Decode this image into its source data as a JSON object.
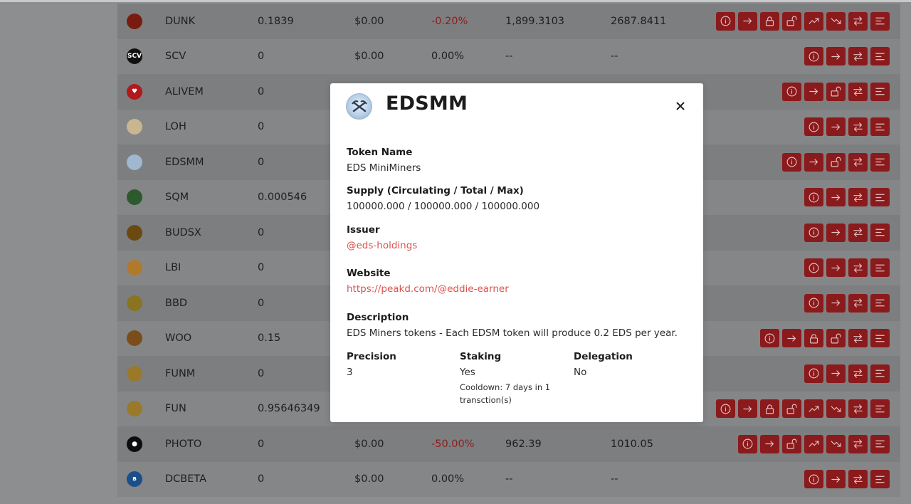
{
  "rows": [
    {
      "symbol": "DUNK",
      "balance": "0.1839",
      "usd": "$0.00",
      "change": "-0.20%",
      "change_negative": true,
      "volume": "1,899.3103",
      "mcap": "2687.8411",
      "icon_bg": "#7a1b10",
      "icon_text": "",
      "actions": [
        "info-icon",
        "transfer-icon",
        "lock-icon",
        "unlock-icon",
        "trend-up-icon",
        "trend-down-icon",
        "swap-icon",
        "menu-icon"
      ]
    },
    {
      "symbol": "SCV",
      "balance": "0",
      "usd": "$0.00",
      "change": "0.00%",
      "change_negative": false,
      "volume": "--",
      "mcap": "--",
      "icon_bg": "#111111",
      "icon_text": "SCV",
      "actions": [
        "info-icon",
        "transfer-icon",
        "swap-icon",
        "menu-icon"
      ]
    },
    {
      "symbol": "ALIVEM",
      "balance": "0",
      "usd": "",
      "change": "",
      "change_negative": false,
      "volume": "",
      "mcap": "",
      "icon_bg": "#b3181c",
      "icon_text": "♥",
      "actions": [
        "info-icon",
        "transfer-icon",
        "unlock-icon",
        "swap-icon",
        "menu-icon"
      ]
    },
    {
      "symbol": "LOH",
      "balance": "0",
      "usd": "",
      "change": "",
      "change_negative": false,
      "volume": "",
      "mcap": "",
      "icon_bg": "#c7b690",
      "icon_text": "",
      "actions": [
        "info-icon",
        "transfer-icon",
        "swap-icon",
        "menu-icon"
      ]
    },
    {
      "symbol": "EDSMM",
      "balance": "0",
      "usd": "",
      "change": "",
      "change_negative": false,
      "volume": "",
      "mcap": "",
      "icon_bg": "#9fb8d0",
      "icon_text": "",
      "actions": [
        "info-icon",
        "transfer-icon",
        "unlock-icon",
        "swap-icon",
        "menu-icon"
      ]
    },
    {
      "symbol": "SQM",
      "balance": "0.000546",
      "usd": "",
      "change": "",
      "change_negative": false,
      "volume": "",
      "mcap": "",
      "icon_bg": "#2d5a2d",
      "icon_text": "",
      "actions": [
        "info-icon",
        "transfer-icon",
        "swap-icon",
        "menu-icon"
      ]
    },
    {
      "symbol": "BUDSX",
      "balance": "0",
      "usd": "",
      "change": "",
      "change_negative": false,
      "volume": "",
      "mcap": "",
      "icon_bg": "#6b4a12",
      "icon_text": "",
      "actions": [
        "info-icon",
        "transfer-icon",
        "swap-icon",
        "menu-icon"
      ]
    },
    {
      "symbol": "LBI",
      "balance": "0",
      "usd": "",
      "change": "",
      "change_negative": false,
      "volume": "",
      "mcap": "",
      "icon_bg": "#b07a2a",
      "icon_text": "",
      "actions": [
        "info-icon",
        "transfer-icon",
        "swap-icon",
        "menu-icon"
      ]
    },
    {
      "symbol": "BBD",
      "balance": "0",
      "usd": "",
      "change": "",
      "change_negative": false,
      "volume": "",
      "mcap": "",
      "icon_bg": "#8a7420",
      "icon_text": "",
      "actions": [
        "info-icon",
        "transfer-icon",
        "swap-icon",
        "menu-icon"
      ]
    },
    {
      "symbol": "WOO",
      "balance": "0.15",
      "usd": "",
      "change": "",
      "change_negative": false,
      "volume": "",
      "mcap": "",
      "icon_bg": "#7a4d1a",
      "icon_text": "",
      "actions": [
        "info-icon",
        "transfer-icon",
        "lock-icon",
        "unlock-icon",
        "swap-icon",
        "menu-icon"
      ]
    },
    {
      "symbol": "FUNM",
      "balance": "0",
      "usd": "",
      "change": "",
      "change_negative": false,
      "volume": "",
      "mcap": "",
      "icon_bg": "#9a7a2a",
      "icon_text": "",
      "actions": [
        "info-icon",
        "transfer-icon",
        "swap-icon",
        "menu-icon"
      ]
    },
    {
      "symbol": "FUN",
      "balance": "0.95646349",
      "usd": "",
      "change": "",
      "change_negative": false,
      "volume": "",
      "mcap": "",
      "icon_bg": "#9a7a2a",
      "icon_text": "",
      "actions": [
        "info-icon",
        "transfer-icon",
        "lock-icon",
        "unlock-icon",
        "trend-up-icon",
        "trend-down-icon",
        "swap-icon",
        "menu-icon"
      ]
    },
    {
      "symbol": "PHOTO",
      "balance": "0",
      "usd": "$0.00",
      "change": "-50.00%",
      "change_negative": true,
      "volume": "962.39",
      "mcap": "1010.05",
      "icon_bg": "#0d0d0d",
      "icon_text": "●",
      "actions": [
        "info-icon",
        "transfer-icon",
        "unlock-icon",
        "trend-up-icon",
        "trend-down-icon",
        "swap-icon",
        "menu-icon"
      ]
    },
    {
      "symbol": "DCBETA",
      "balance": "0",
      "usd": "$0.00",
      "change": "0.00%",
      "change_negative": false,
      "volume": "--",
      "mcap": "--",
      "icon_bg": "#1b4f8a",
      "icon_text": "в",
      "actions": [
        "info-icon",
        "transfer-icon",
        "swap-icon",
        "menu-icon"
      ]
    }
  ],
  "modal": {
    "title": "EDSMM",
    "token_name_label": "Token Name",
    "token_name": "EDS MiniMiners",
    "supply_label": "Supply (Circulating / Total / Max)",
    "supply": "100000.000 / 100000.000 / 100000.000",
    "issuer_label": "Issuer",
    "issuer": "@eds-holdings",
    "website_label": "Website",
    "website": "https://peakd.com/@eddie-earner",
    "description_label": "Description",
    "description": "EDS Miners tokens - Each EDSM token will produce 0.2 EDS per year.",
    "precision_label": "Precision",
    "precision": "3",
    "staking_label": "Staking",
    "staking": "Yes",
    "cooldown": "Cooldown: 7 days in 1 transction(s)",
    "delegation_label": "Delegation",
    "delegation": "No"
  },
  "colors": {
    "action_button": "#8a1a1c",
    "negative_change": "#8b1f1f",
    "link": "#d9534f"
  }
}
